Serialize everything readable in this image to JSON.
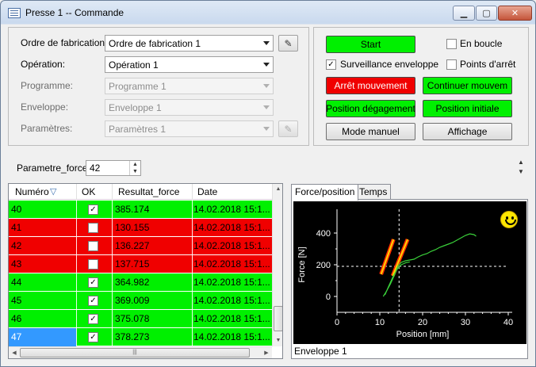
{
  "window": {
    "title": "Presse 1 -- Commande"
  },
  "form": {
    "ordre_label": "Ordre de fabrication:",
    "ordre_value": "Ordre de fabrication 1",
    "operation_label": "Opération:",
    "operation_value": "Opération 1",
    "programme_label": "Programme:",
    "programme_value": "Programme 1",
    "enveloppe_label": "Enveloppe:",
    "enveloppe_value": "Enveloppe 1",
    "parametres_label": "Paramètres:",
    "parametres_value": "Paramètres 1"
  },
  "controls": {
    "start": "Start",
    "en_boucle": "En boucle",
    "surveillance": "Surveillance enveloppe",
    "points_arret": "Points d'arrêt",
    "arret": "Arrêt mouvement",
    "continuer": "Continuer mouvem",
    "position_degagement": "Position dégagement",
    "position_initiale": "Position initiale",
    "mode_manuel": "Mode manuel",
    "affichage": "Affichage",
    "surveillance_checked": true,
    "en_boucle_checked": false,
    "points_arret_checked": false
  },
  "parametre_force": {
    "label": "Parametre_force:",
    "value": "42"
  },
  "grid": {
    "headers": [
      "Numéro",
      "OK",
      "Resultat_force",
      "Date"
    ],
    "rows": [
      {
        "num": "40",
        "ok": true,
        "force": "385.174",
        "date": "14.02.2018 15:1..."
      },
      {
        "num": "41",
        "ok": false,
        "force": "130.155",
        "date": "14.02.2018 15:1..."
      },
      {
        "num": "42",
        "ok": false,
        "force": "136.227",
        "date": "14.02.2018 15:1..."
      },
      {
        "num": "43",
        "ok": false,
        "force": "137.715",
        "date": "14.02.2018 15:1..."
      },
      {
        "num": "44",
        "ok": true,
        "force": "364.982",
        "date": "14.02.2018 15:1..."
      },
      {
        "num": "45",
        "ok": true,
        "force": "369.009",
        "date": "14.02.2018 15:1..."
      },
      {
        "num": "46",
        "ok": true,
        "force": "375.078",
        "date": "14.02.2018 15:1..."
      },
      {
        "num": "47",
        "ok": true,
        "force": "378.273",
        "date": "14.02.2018 15:1..."
      }
    ],
    "selected_index": 7
  },
  "tabs": [
    "Force/position",
    "Temps"
  ],
  "envelope_label": "Enveloppe 1",
  "colors": {
    "ok": "#00f000",
    "nok": "#f00000",
    "selected": "#3399ff",
    "curve": "#3ad13a",
    "envelope": "#ffd400"
  },
  "chart_data": {
    "type": "line",
    "xlabel": "Position [mm]",
    "ylabel": "Force [N]",
    "xlim": [
      0,
      40
    ],
    "ylim": [
      -100,
      500
    ],
    "xticks": [
      0,
      10,
      20,
      30,
      40
    ],
    "yticks": [
      0,
      200,
      400
    ],
    "series": [
      {
        "x": [
          10.8,
          11.5,
          12.5,
          13.5,
          14.2,
          15.0,
          16.0,
          17.0,
          18.0,
          19.0,
          20.0,
          21.0,
          22.0,
          23.0,
          24.0,
          25.0,
          26.0,
          27.0,
          28.0,
          29.0,
          30.0,
          31.0,
          32.0,
          32.5
        ],
        "y": [
          0,
          30,
          80,
          140,
          190,
          215,
          225,
          230,
          235,
          250,
          262,
          270,
          285,
          295,
          310,
          320,
          330,
          340,
          355,
          370,
          385,
          395,
          390,
          380
        ]
      },
      {
        "x": [
          11.2,
          12.0,
          13.0,
          14.0,
          15.0,
          16.0,
          17.0
        ],
        "y": [
          10,
          60,
          120,
          170,
          200,
          212,
          218
        ]
      }
    ],
    "envelope_segments": [
      {
        "x": [
          10.3,
          13.2
        ],
        "y": [
          140,
          360
        ]
      },
      {
        "x": [
          13.0,
          16.5
        ],
        "y": [
          130,
          360
        ]
      }
    ],
    "crosshair": {
      "x": 14.5,
      "y": 190
    }
  }
}
